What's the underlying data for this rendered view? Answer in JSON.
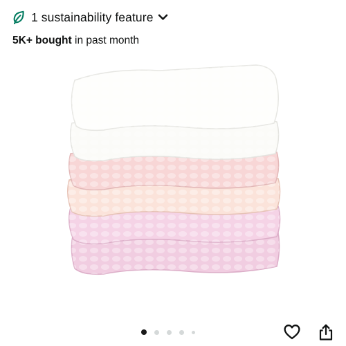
{
  "sustainability": {
    "text": "1 sustainability feature",
    "icon": "leaf-icon",
    "expand_icon": "chevron-down-icon",
    "color": "#067d62"
  },
  "purchases": {
    "count": "5K+ bought",
    "suffix": " in past month"
  },
  "gallery": {
    "image": "stack of muslin baby washcloths in white, peach and pink",
    "total_images": 5,
    "current_index": 1
  },
  "actions": {
    "favorite_icon": "heart-icon",
    "share_icon": "share-icon"
  }
}
